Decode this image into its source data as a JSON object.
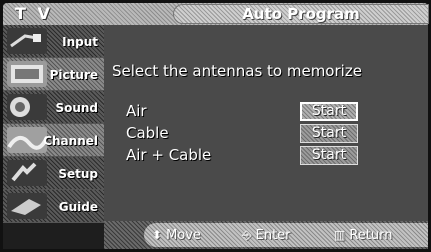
{
  "header": {
    "mode_label": "T V",
    "title": "Auto Program"
  },
  "sidebar": {
    "items": [
      {
        "label": "Input",
        "icon": "input-cable-icon",
        "active": false
      },
      {
        "label": "Picture",
        "icon": "picture-icon",
        "active": true
      },
      {
        "label": "Sound",
        "icon": "sound-icon",
        "active": false
      },
      {
        "label": "Channel",
        "icon": "channel-icon",
        "active": true
      },
      {
        "label": "Setup",
        "icon": "setup-icon",
        "active": false
      },
      {
        "label": "Guide",
        "icon": "guide-icon",
        "active": false
      }
    ]
  },
  "main": {
    "instruction": "Select the antennas to memorize",
    "options": [
      {
        "label": "Air",
        "button": "Start",
        "selected": true
      },
      {
        "label": "Cable",
        "button": "Start",
        "selected": false
      },
      {
        "label": "Air + Cable",
        "button": "Start",
        "selected": false
      }
    ]
  },
  "navbar": {
    "move": "Move",
    "enter": "Enter",
    "return": "Return"
  },
  "colors": {
    "frame": "#111111",
    "text": "#ffffff",
    "panel": "#4a4a4a"
  }
}
